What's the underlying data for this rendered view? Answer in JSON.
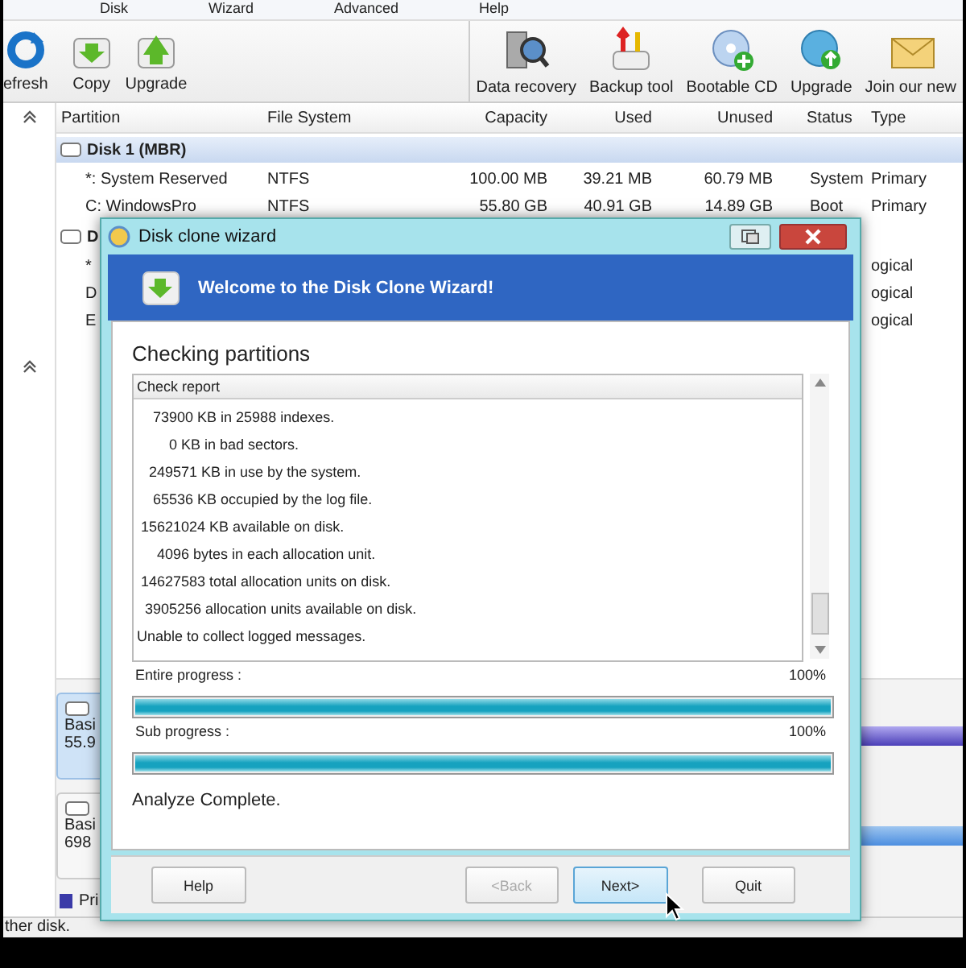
{
  "menu": [
    "Disk",
    "Wizard",
    "Advanced",
    "Help"
  ],
  "toolbar_left": [
    "efresh",
    "Copy",
    "Upgrade"
  ],
  "toolbar_right": [
    "Data recovery",
    "Backup tool",
    "Bootable CD",
    "Upgrade",
    "Join our new"
  ],
  "table": {
    "columns": [
      "Partition",
      "File System",
      "Capacity",
      "Used",
      "Unused",
      "Status",
      "Type"
    ],
    "disks": [
      {
        "name": "Disk 1 (MBR)",
        "rows": [
          [
            "*: System Reserved",
            "NTFS",
            "100.00 MB",
            "39.21 MB",
            "60.79 MB",
            "System",
            "Primary"
          ],
          [
            "C: WindowsPro",
            "NTFS",
            "55.80 GB",
            "40.91 GB",
            "14.89 GB",
            "Boot",
            "Primary"
          ]
        ]
      },
      {
        "name": "D",
        "rows": [
          [
            "*",
            "",
            "",
            "",
            "",
            "",
            "ogical"
          ],
          [
            "D",
            "",
            "",
            "",
            "",
            "",
            "ogical"
          ],
          [
            "E",
            "",
            "",
            "",
            "",
            "",
            "ogical"
          ]
        ]
      }
    ]
  },
  "disk_map": [
    {
      "label": "Basi",
      "size": "55.9",
      "selected": true
    },
    {
      "label": "Basi",
      "size": "698",
      "selected": false
    }
  ],
  "legend": "Pri",
  "status_bar": "ther disk.",
  "dialog": {
    "title": "Disk clone wizard",
    "banner": "Welcome to the Disk Clone Wizard!",
    "heading": "Checking partitions",
    "report": {
      "header": "Check report",
      "lines": [
        "    73900 KB in 25988 indexes.",
        "        0 KB in bad sectors.",
        "   249571 KB in use by the system.",
        "    65536 KB occupied by the log file.",
        " 15621024 KB available on disk.",
        "     4096 bytes in each allocation unit.",
        " 14627583 total allocation units on disk.",
        "  3905256 allocation units available on disk.",
        "Unable to collect logged messages."
      ]
    },
    "progress": [
      {
        "label": "Entire progress :",
        "reading": "100%",
        "level": 1
      },
      {
        "label": "Sub progress :",
        "reading": "100%",
        "level": 1
      }
    ],
    "result": "Analyze Complete.",
    "buttons": [
      {
        "label": "Help",
        "disabled": false,
        "selected": false
      },
      {
        "label": "<Back",
        "disabled": true,
        "selected": false
      },
      {
        "label": "Next>",
        "disabled": false,
        "selected": true
      },
      {
        "label": "Quit",
        "disabled": false,
        "selected": false
      }
    ]
  }
}
